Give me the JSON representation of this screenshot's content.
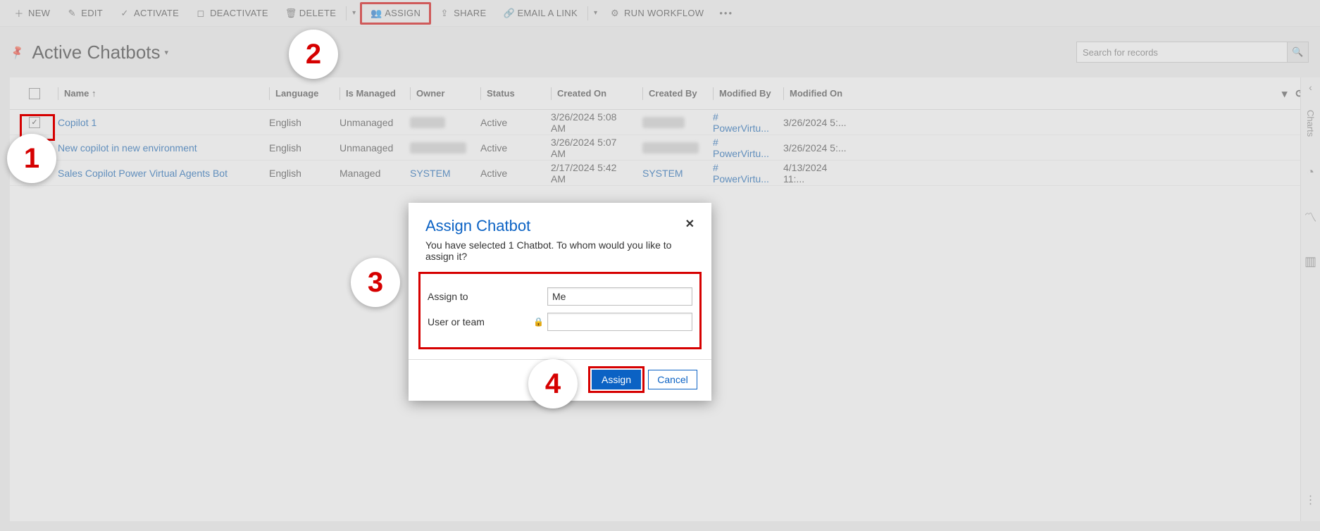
{
  "cmdbar": {
    "new": "NEW",
    "edit": "EDIT",
    "activate": "ACTIVATE",
    "deactivate": "DEACTIVATE",
    "delete": "DELETE",
    "assign": "ASSIGN",
    "share": "SHARE",
    "email": "EMAIL A LINK",
    "workflow": "RUN WORKFLOW"
  },
  "view": {
    "title": "Active Chatbots",
    "search_placeholder": "Search for records"
  },
  "grid": {
    "headers": {
      "name": "Name ↑",
      "language": "Language",
      "is_managed": "Is Managed",
      "owner": "Owner",
      "status": "Status",
      "created_on": "Created On",
      "created_by": "Created By",
      "modified_by": "Modified By",
      "modified_on": "Modified On"
    },
    "rows": [
      {
        "checked": true,
        "name": "Copilot 1",
        "language": "English",
        "is_managed": "Unmanaged",
        "owner_blur": true,
        "owner": "████",
        "status": "Active",
        "created_on": "3/26/2024 5:08 AM",
        "created_by_blur": true,
        "created_by": "██████",
        "modified_by": "# PowerVirtu...",
        "modified_on": "3/26/2024 5:..."
      },
      {
        "checked": false,
        "name": "New copilot in new environment",
        "language": "English",
        "is_managed": "Unmanaged",
        "owner_blur": true,
        "owner": "█████████",
        "status": "Active",
        "created_on": "3/26/2024 5:07 AM",
        "created_by_blur": true,
        "created_by": "██████████",
        "modified_by": "# PowerVirtu...",
        "modified_on": "3/26/2024 5:..."
      },
      {
        "checked": false,
        "name": "Sales Copilot Power Virtual Agents Bot",
        "language": "English",
        "is_managed": "Managed",
        "owner": "SYSTEM",
        "status": "Active",
        "created_on": "2/17/2024 5:42 AM",
        "created_by": "SYSTEM",
        "modified_by": "# PowerVirtu...",
        "modified_on": "4/13/2024 11:..."
      }
    ]
  },
  "rail": {
    "label": "Charts"
  },
  "modal": {
    "title": "Assign Chatbot",
    "subtitle": "You have selected 1 Chatbot. To whom would you like to assign it?",
    "assign_to_label": "Assign to",
    "assign_to_value": "Me",
    "user_team_label": "User or team",
    "assign_btn": "Assign",
    "cancel_btn": "Cancel"
  },
  "callouts": {
    "c1": "1",
    "c2": "2",
    "c3": "3",
    "c4": "4"
  }
}
